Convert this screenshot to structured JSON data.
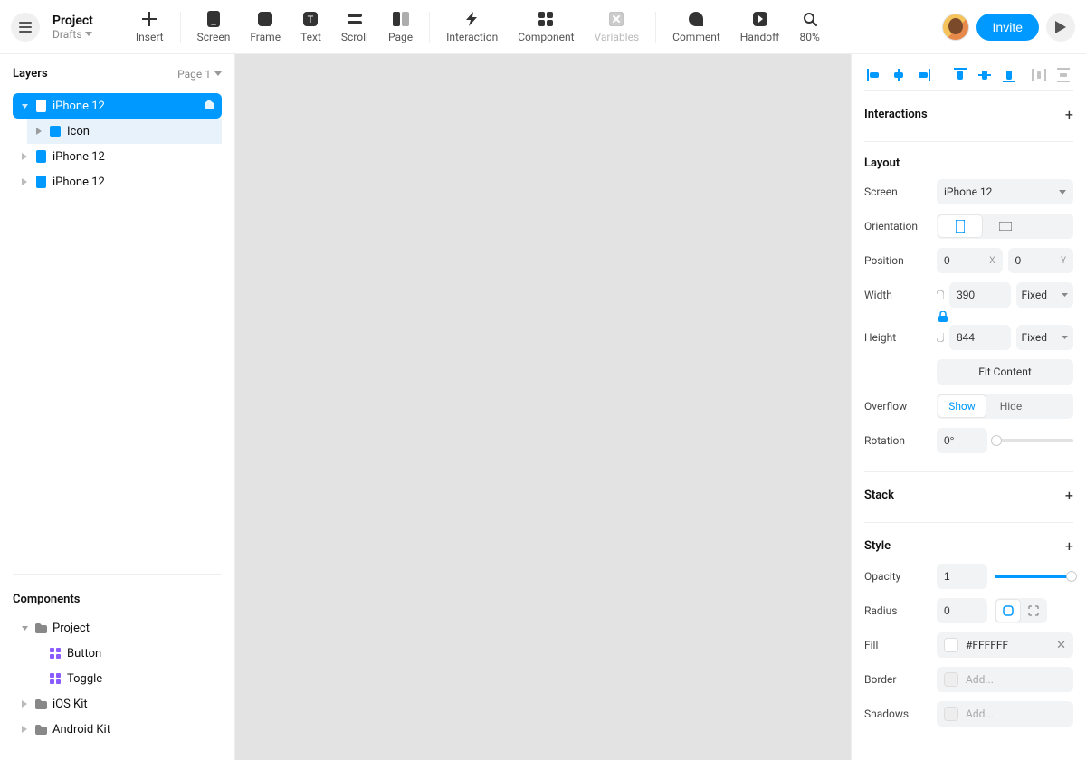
{
  "header": {
    "project_title": "Project",
    "project_subtitle": "Drafts",
    "invite_label": "Invite",
    "tools": {
      "insert": "Insert",
      "screen": "Screen",
      "frame": "Frame",
      "text": "Text",
      "scroll": "Scroll",
      "page": "Page",
      "interaction": "Interaction",
      "component": "Component",
      "variables": "Variables",
      "comment": "Comment",
      "handoff": "Handoff",
      "zoom": "80%"
    }
  },
  "left": {
    "title": "Layers",
    "page_label": "Page 1",
    "layers": [
      {
        "name": "iPhone 12",
        "selected": true,
        "expanded": true,
        "locked": true
      },
      {
        "name": "Icon",
        "child": true
      },
      {
        "name": "iPhone 12"
      },
      {
        "name": "iPhone 12"
      }
    ],
    "components_title": "Components",
    "components": {
      "project": "Project",
      "button": "Button",
      "toggle": "Toggle",
      "ios": "iOS Kit",
      "android": "Android Kit"
    }
  },
  "right": {
    "interactions_title": "Interactions",
    "layout_title": "Layout",
    "screen_label": "Screen",
    "screen_value": "iPhone 12",
    "orientation_label": "Orientation",
    "position_label": "Position",
    "pos_x": "0",
    "pos_y": "0",
    "width_label": "Width",
    "width_value": "390",
    "height_label": "Height",
    "height_value": "844",
    "fixed_label": "Fixed",
    "fit_label": "Fit Content",
    "overflow_label": "Overflow",
    "overflow_show": "Show",
    "overflow_hide": "Hide",
    "rotation_label": "Rotation",
    "rotation_value": "0°",
    "stack_title": "Stack",
    "style_title": "Style",
    "opacity_label": "Opacity",
    "opacity_value": "1",
    "radius_label": "Radius",
    "radius_value": "0",
    "fill_label": "Fill",
    "fill_value": "#FFFFFF",
    "border_label": "Border",
    "shadows_label": "Shadows",
    "add_placeholder": "Add..."
  }
}
